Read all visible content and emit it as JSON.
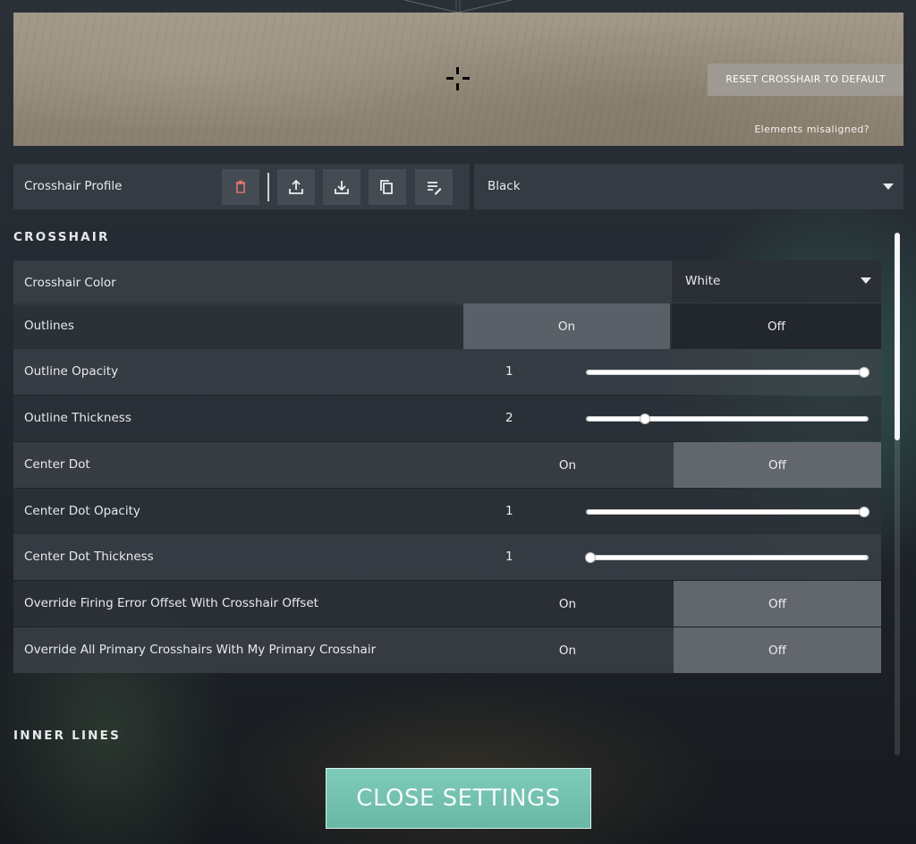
{
  "preview": {
    "reset_label": "RESET CROSSHAIR TO DEFAULT",
    "misaligned_link": "Elements misaligned?"
  },
  "profile": {
    "label": "Crosshair Profile",
    "selected": "Black",
    "actions": [
      "trash-icon",
      "upload-icon",
      "download-icon",
      "copy-icon",
      "rename-icon"
    ]
  },
  "sections": {
    "crosshair_title": "CROSSHAIR",
    "inner_lines_title": "INNER LINES"
  },
  "settings": {
    "crosshair_color": {
      "label": "Crosshair Color",
      "value": "White"
    },
    "outlines": {
      "label": "Outlines",
      "on": "On",
      "off": "Off",
      "selected": "On"
    },
    "outline_opacity": {
      "label": "Outline Opacity",
      "value": "1",
      "fraction": 1.0
    },
    "outline_thickness": {
      "label": "Outline Thickness",
      "value": "2",
      "fraction": 0.2
    },
    "center_dot": {
      "label": "Center Dot",
      "on": "On",
      "off": "Off",
      "selected": "Off"
    },
    "center_dot_opacity": {
      "label": "Center Dot Opacity",
      "value": "1",
      "fraction": 1.0
    },
    "center_dot_thickness": {
      "label": "Center Dot Thickness",
      "value": "1",
      "fraction": 0.0
    },
    "override_firing_error": {
      "label": "Override Firing Error Offset With Crosshair Offset",
      "on": "On",
      "off": "Off",
      "selected": "Off"
    },
    "override_primary": {
      "label": "Override All Primary Crosshairs With My Primary Crosshair",
      "on": "On",
      "off": "Off",
      "selected": "Off"
    }
  },
  "footer": {
    "close_label": "CLOSE SETTINGS"
  },
  "colors": {
    "accent": "#6fbfad",
    "panel": "#343b43"
  }
}
